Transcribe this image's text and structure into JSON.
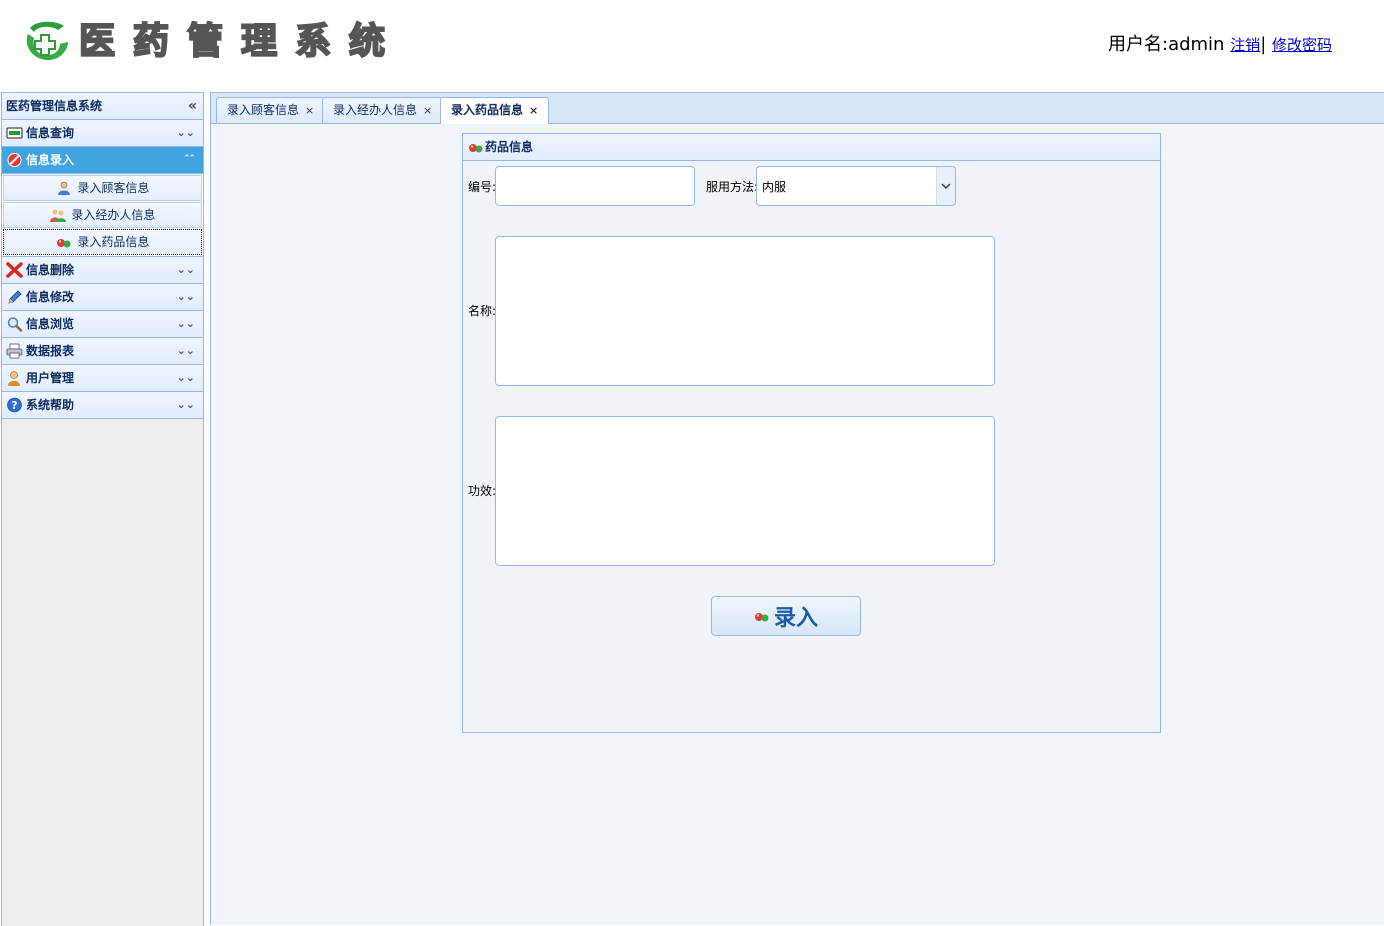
{
  "header": {
    "logo_chars": [
      "医",
      "药",
      "管",
      "理",
      "系",
      "统"
    ],
    "user_label": "用户名:admin",
    "logout_link": "注销",
    "separator": "|",
    "change_password_link": "修改密码"
  },
  "sidebar": {
    "title": "医药管理信息系统",
    "sections": [
      {
        "label": "信息查询",
        "icon": "card-icon",
        "expanded": false
      },
      {
        "label": "信息录入",
        "icon": "forbidden-icon",
        "expanded": true,
        "items": [
          {
            "label": "录入顾客信息",
            "icon": "user-icon"
          },
          {
            "label": "录入经办人信息",
            "icon": "users-icon"
          },
          {
            "label": "录入药品信息",
            "icon": "pills-icon",
            "selected": true
          }
        ]
      },
      {
        "label": "信息删除",
        "icon": "delete-x-icon",
        "expanded": false
      },
      {
        "label": "信息修改",
        "icon": "pencil-icon",
        "expanded": false
      },
      {
        "label": "信息浏览",
        "icon": "magnifier-icon",
        "expanded": false
      },
      {
        "label": "数据报表",
        "icon": "printer-icon",
        "expanded": false
      },
      {
        "label": "用户管理",
        "icon": "user-manage-icon",
        "expanded": false
      },
      {
        "label": "系统帮助",
        "icon": "help-icon",
        "expanded": false
      }
    ]
  },
  "tabs": [
    {
      "label": "录入顾客信息",
      "close": "×"
    },
    {
      "label": "录入经办人信息",
      "close": "×"
    },
    {
      "label": "录入药品信息",
      "close": "×",
      "active": true
    }
  ],
  "form": {
    "panel_title": "药品信息",
    "code_label": "编号:",
    "code_value": "",
    "method_label": "服用方法:",
    "method_value": "内服",
    "name_label": "名称:",
    "name_value": "",
    "effect_label": "功效:",
    "effect_value": "",
    "submit_label": "录入"
  },
  "colors": {
    "accent_active": "#3fa4e0",
    "border": "#95b8e7",
    "title_text": "#0e2d5f"
  }
}
